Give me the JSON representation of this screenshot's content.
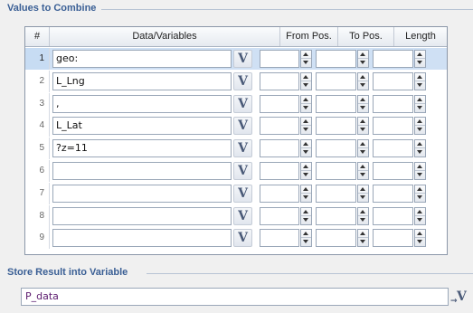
{
  "values_section": {
    "title": "Values to Combine"
  },
  "grid": {
    "columns": {
      "num": "#",
      "data": "Data/Variables",
      "from": "From Pos.",
      "to": "To Pos.",
      "length": "Length"
    },
    "rows": [
      {
        "num": "1",
        "value": "geo:",
        "from": "",
        "to": "",
        "length": "",
        "selected": true
      },
      {
        "num": "2",
        "value": "L_Lng",
        "from": "",
        "to": "",
        "length": ""
      },
      {
        "num": "3",
        "value": ",",
        "from": "",
        "to": "",
        "length": ""
      },
      {
        "num": "4",
        "value": "L_Lat",
        "from": "",
        "to": "",
        "length": ""
      },
      {
        "num": "5",
        "value": "?z=11",
        "from": "",
        "to": "",
        "length": ""
      },
      {
        "num": "6",
        "value": "",
        "from": "",
        "to": "",
        "length": ""
      },
      {
        "num": "7",
        "value": "",
        "from": "",
        "to": "",
        "length": ""
      },
      {
        "num": "8",
        "value": "",
        "from": "",
        "to": "",
        "length": ""
      },
      {
        "num": "9",
        "value": "",
        "from": "",
        "to": "",
        "length": ""
      }
    ],
    "variable_button_label": "V"
  },
  "store_section": {
    "title": "Store Result into Variable",
    "value": "P_data",
    "button_label": "V"
  },
  "colors": {
    "section_title": "#3a5f95",
    "selected_row": "#cfe0f4",
    "variable_text": "#5b1a6e"
  }
}
